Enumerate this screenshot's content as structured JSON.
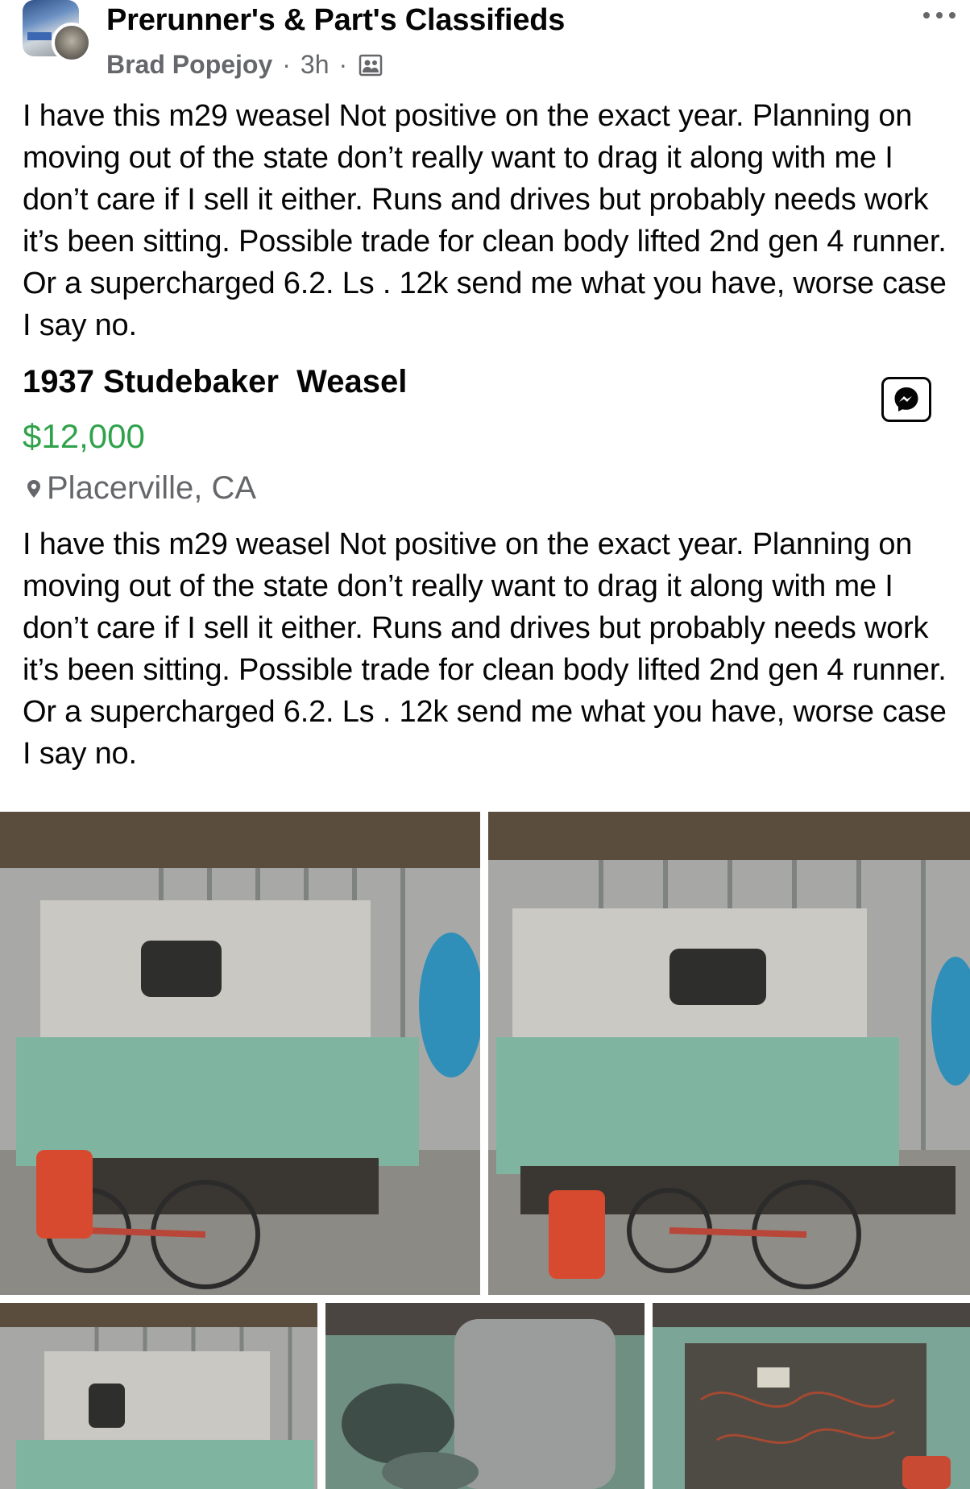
{
  "post": {
    "group_name": "Prerunner's & Part's Classifieds",
    "author": "Brad Popejoy",
    "time": "3h",
    "separator": "·",
    "text": "I have this m29 weasel Not positive on the exact year. Planning on moving out of the state don’t really want to drag it along with me I don’t care if I sell it either. Runs and drives but probably needs work it’s been sitting. Possible trade for clean body lifted  2nd gen 4 runner. Or a supercharged 6.2. Ls . 12k send me what you have, worse case I say no."
  },
  "listing": {
    "title": "1937 Studebaker  Weasel",
    "price": "$12,000",
    "location": "Placerville, CA",
    "description": "I have this m29 weasel Not positive on the exact year. Planning on moving out of the state don’t really want to drag it along with me I don’t care if I sell it either. Runs and drives but probably needs work it’s been sitting. Possible trade for clean body lifted  2nd gen 4 runner. Or a supercharged 6.2. Ls . 12k send me what you have, worse case I say no."
  },
  "icons": {
    "more": "more-options-icon",
    "group_visibility": "group-members-icon",
    "messenger": "messenger-icon",
    "location": "location-pin-icon"
  },
  "colors": {
    "price": "#31a24c",
    "secondary_text": "#65676b",
    "vehicle_body": "#7fb5a0"
  }
}
